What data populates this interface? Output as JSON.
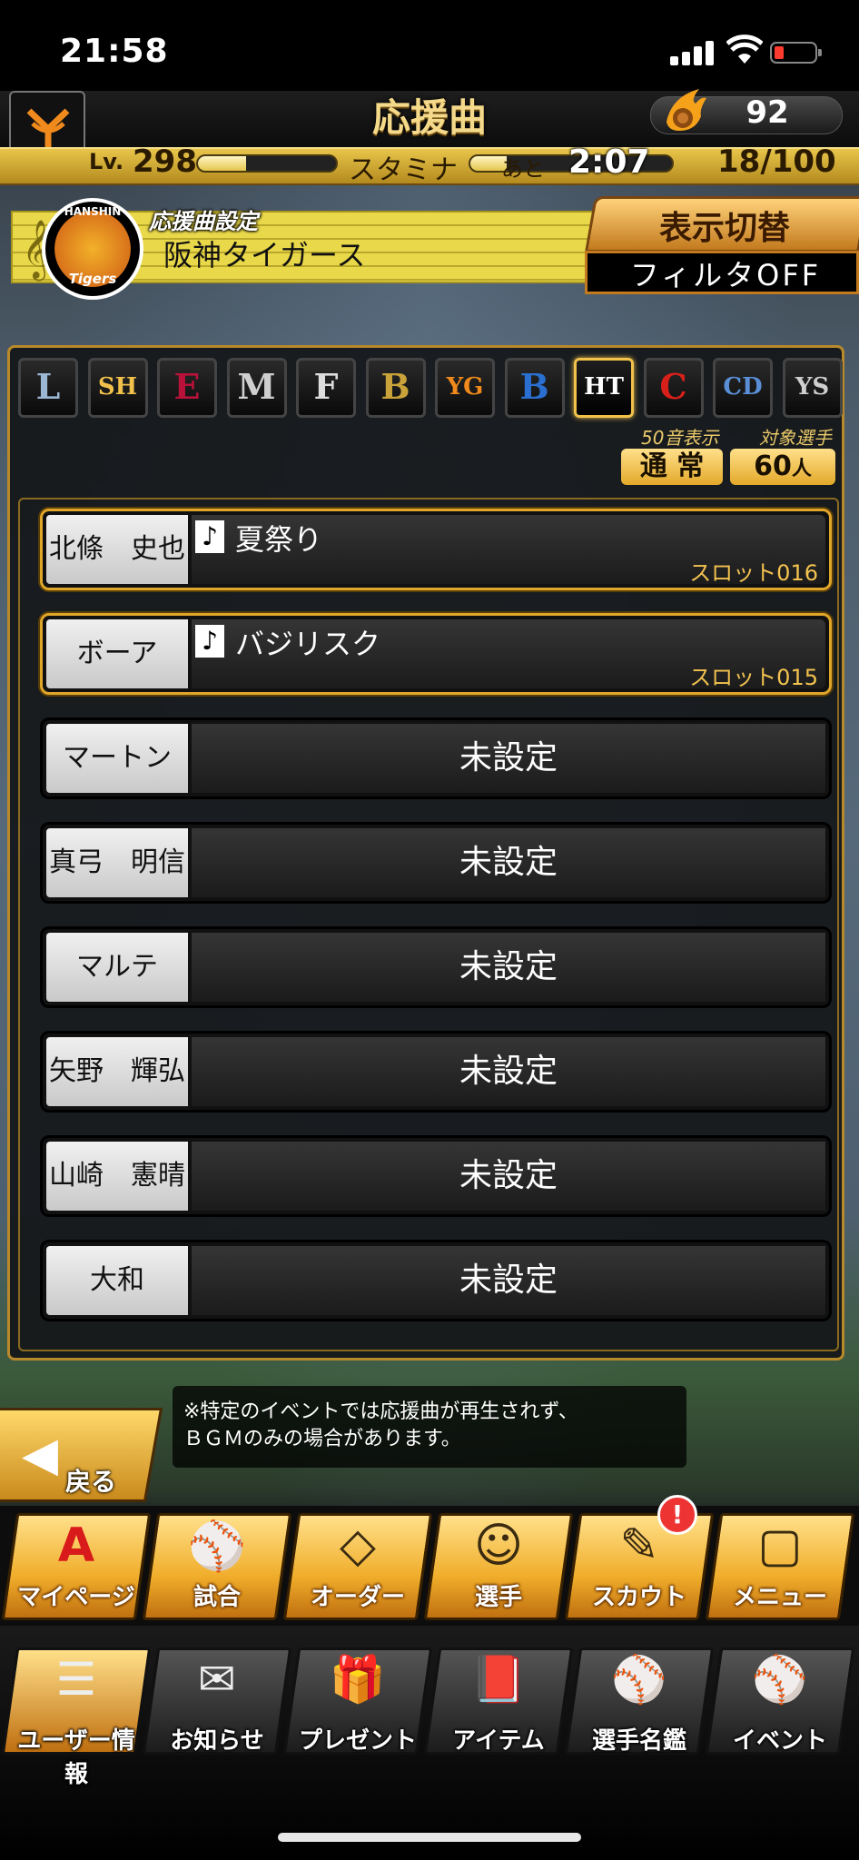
{
  "status_bar": {
    "time": "21:58"
  },
  "header": {
    "title": "応援曲",
    "stone_count": "92",
    "level_label": "Lv.",
    "level_value": "298",
    "stamina_label": "スタミナ",
    "ato_label": "あと",
    "ato_time": "2:07",
    "stamina_count": "18/100",
    "exp_fraction": 0.35,
    "stamina_fraction": 0.18
  },
  "setting": {
    "label": "応援曲設定",
    "team_name": "阪神タイガース",
    "logo_top": "HANSHIN",
    "logo_bottom": "Tigers",
    "switch_label": "表示切替",
    "filter_label": "フィルタOFF"
  },
  "team_tabs": [
    {
      "mark": "L",
      "name": "lions",
      "color": "#9bb7d4"
    },
    {
      "mark": "SH",
      "name": "hawks",
      "color": "#f1c14b"
    },
    {
      "mark": "E",
      "name": "eagles",
      "color": "#b8123a"
    },
    {
      "mark": "M",
      "name": "marines",
      "color": "#cfcfcf"
    },
    {
      "mark": "F",
      "name": "fighters",
      "color": "#ddd"
    },
    {
      "mark": "B",
      "name": "buffaloes",
      "color": "#c9a23a"
    },
    {
      "mark": "YG",
      "name": "giants",
      "color": "#f08a1c"
    },
    {
      "mark": "B",
      "name": "baystars",
      "color": "#2a6fd0"
    },
    {
      "mark": "HT",
      "name": "tigers",
      "color": "#ffffff",
      "active": true
    },
    {
      "mark": "C",
      "name": "carp",
      "color": "#d8201a"
    },
    {
      "mark": "CD",
      "name": "dragons",
      "color": "#5a8fd8"
    },
    {
      "mark": "YS",
      "name": "swallows",
      "color": "#cfcfcf"
    }
  ],
  "sort": {
    "label": "50音表示",
    "value": "通 常",
    "target_label": "対象選手",
    "target_count": "60",
    "target_unit": "人"
  },
  "players": [
    {
      "name": "北條　史也",
      "song": "夏祭り",
      "slot": "スロット016",
      "set": true
    },
    {
      "name": "ボーア",
      "song": "バジリスク",
      "slot": "スロット015",
      "set": true
    },
    {
      "name": "マートン",
      "status": "未設定",
      "set": false
    },
    {
      "name": "真弓　明信",
      "status": "未設定",
      "set": false
    },
    {
      "name": "マルテ",
      "status": "未設定",
      "set": false
    },
    {
      "name": "矢野　輝弘",
      "status": "未設定",
      "set": false
    },
    {
      "name": "山崎　憲晴",
      "status": "未設定",
      "set": false
    },
    {
      "name": "大和",
      "status": "未設定",
      "set": false
    }
  ],
  "note": "♪",
  "back": {
    "label": "戻る"
  },
  "notice": {
    "line1": "※特定のイベントでは応援曲が再生されず、",
    "line2": "ＢＧＭのみの場合があります。"
  },
  "menu_main": [
    {
      "label": "マイページ"
    },
    {
      "label": "試合"
    },
    {
      "label": "オーダー"
    },
    {
      "label": "選手"
    },
    {
      "label": "スカウト"
    },
    {
      "label": "メニュー"
    }
  ],
  "menu_sub": [
    {
      "label": "ユーザー情報"
    },
    {
      "label": "お知らせ"
    },
    {
      "label": "プレゼント"
    },
    {
      "label": "アイテム"
    },
    {
      "label": "選手名鑑"
    },
    {
      "label": "イベント"
    }
  ],
  "scout_badge": "!"
}
